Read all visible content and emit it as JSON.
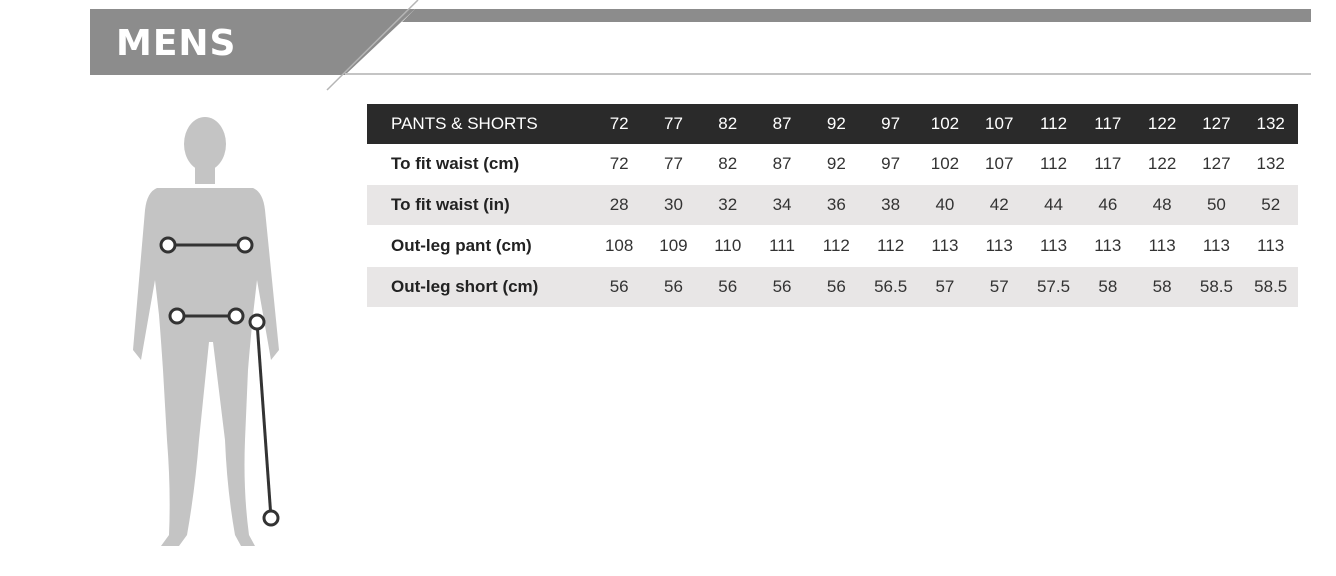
{
  "header": {
    "title": "MENS",
    "colors": {
      "bar": "#8c8c8c",
      "title_text": "#ffffff",
      "rule": "#bdbdbd"
    }
  },
  "figure": {
    "description_icon": "body-measurement-icon",
    "colors": {
      "silhouette": "#c4c4c4",
      "markers": "#333333"
    }
  },
  "table": {
    "header_label": "PANTS & SHORTS",
    "sizes": [
      "72",
      "77",
      "82",
      "87",
      "92",
      "97",
      "102",
      "107",
      "112",
      "117",
      "122",
      "127",
      "132"
    ],
    "rows": [
      {
        "label": "To fit waist (cm)",
        "values": [
          "72",
          "77",
          "82",
          "87",
          "92",
          "97",
          "102",
          "107",
          "112",
          "117",
          "122",
          "127",
          "132"
        ]
      },
      {
        "label": "To fit waist (in)",
        "values": [
          "28",
          "30",
          "32",
          "34",
          "36",
          "38",
          "40",
          "42",
          "44",
          "46",
          "48",
          "50",
          "52"
        ]
      },
      {
        "label": "Out-leg pant (cm)",
        "values": [
          "108",
          "109",
          "110",
          "111",
          "112",
          "112",
          "113",
          "113",
          "113",
          "113",
          "113",
          "113",
          "113"
        ]
      },
      {
        "label": "Out-leg short (cm)",
        "values": [
          "56",
          "56",
          "56",
          "56",
          "56",
          "56.5",
          "57",
          "57",
          "57.5",
          "58",
          "58",
          "58.5",
          "58.5"
        ]
      }
    ]
  }
}
